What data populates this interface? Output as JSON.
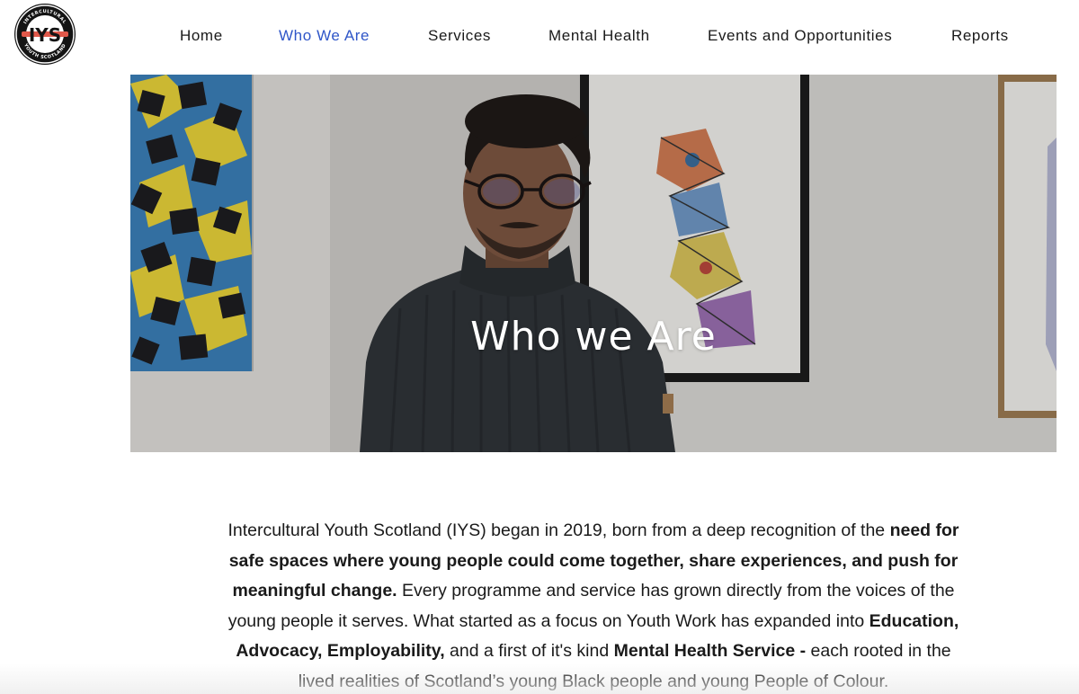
{
  "logo": {
    "text_top": "INTERCULTURAL",
    "text_letters": "IYS",
    "text_bottom": "YOUTH SCOTLAND",
    "icon": "iys-logo-icon"
  },
  "nav": {
    "items": [
      {
        "label": "Home",
        "active": false
      },
      {
        "label": "Who We Are",
        "active": true
      },
      {
        "label": "Services",
        "active": false
      },
      {
        "label": "Mental Health",
        "active": false
      },
      {
        "label": "Events and Opportunities",
        "active": false
      },
      {
        "label": "Reports",
        "active": false
      }
    ],
    "active_color": "#2f56c8"
  },
  "hero": {
    "title": "Who we Are"
  },
  "intro": {
    "p1": "Intercultural Youth Scotland (IYS) began in 2019, born from a deep recognition of the ",
    "p1_bold": "need for safe spaces where young people could come together, share experiences, and push for meaningful change.",
    "p2": " Every programme and service has grown directly from the voices of the young people it serves. What started as a focus on Youth Work has expanded into ",
    "p2_bold": "Education, Advocacy, Employability,",
    "p3": " and a first of it's kind ",
    "p3_bold": "Mental Health Service -",
    "p4": " each rooted in the lived realities of Scotland’s young Black people and young People of Colour."
  }
}
